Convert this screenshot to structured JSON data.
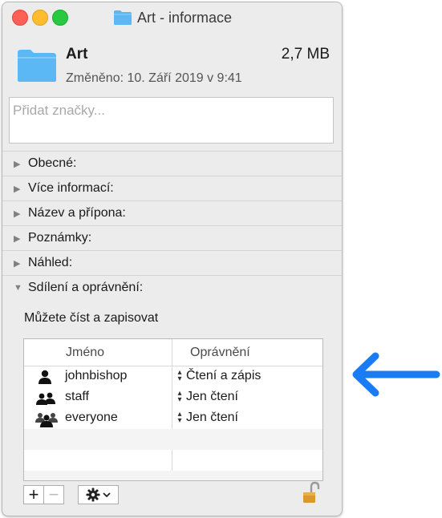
{
  "window": {
    "title": "Art - informace"
  },
  "file": {
    "name": "Art",
    "size": "2,7 MB",
    "modified": "Změněno: 10. Září 2019 v 9:41"
  },
  "tags": {
    "placeholder": "Přidat značky..."
  },
  "sections": [
    {
      "label": "Obecné:",
      "expanded": false
    },
    {
      "label": "Více informací:",
      "expanded": false
    },
    {
      "label": "Název a přípona:",
      "expanded": false
    },
    {
      "label": "Poznámky:",
      "expanded": false
    },
    {
      "label": "Náhled:",
      "expanded": false
    },
    {
      "label": "Sdílení a oprávnění:",
      "expanded": true
    }
  ],
  "permissions": {
    "summary": "Můžete číst a zapisovat",
    "columns": {
      "name": "Jméno",
      "permission": "Oprávnění"
    },
    "rows": [
      {
        "name": "johnbishop",
        "permission": "Čtení a zápis",
        "icon": "user-icon"
      },
      {
        "name": "staff",
        "permission": "Jen čtení",
        "icon": "group-icon"
      },
      {
        "name": "everyone",
        "permission": "Jen čtení",
        "icon": "everyone-icon"
      }
    ]
  },
  "toolbar": {
    "add": "+",
    "remove": "−"
  },
  "colors": {
    "folder": "#5cb8f5",
    "annotation_arrow": "#1a7cf5"
  }
}
